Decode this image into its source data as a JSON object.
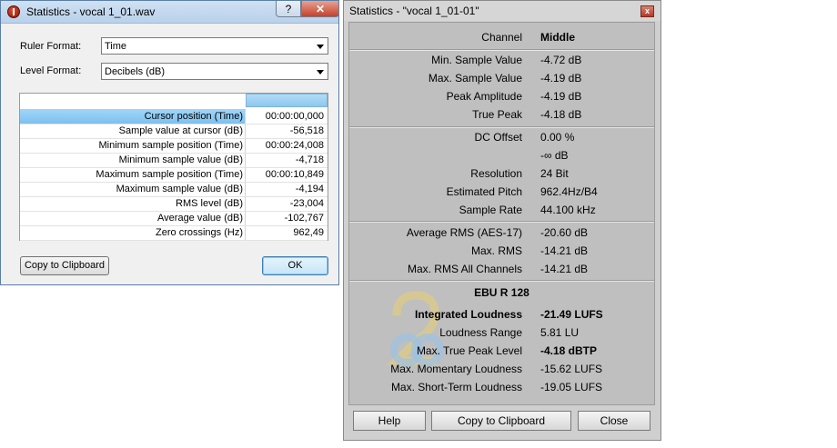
{
  "left_dialog": {
    "title": "Statistics - vocal 1_01.wav",
    "help_caption": "?",
    "close_caption": "✕",
    "ruler_label": "Ruler Format:",
    "ruler_value": "Time",
    "level_label": "Level Format:",
    "level_value": "Decibels (dB)",
    "rows": [
      {
        "label": "Cursor position (Time)",
        "value": "00:00:00,000"
      },
      {
        "label": "Sample value at cursor (dB)",
        "value": "-56,518"
      },
      {
        "label": "Minimum sample position (Time)",
        "value": "00:00:24,008"
      },
      {
        "label": "Minimum sample value (dB)",
        "value": "-4,718"
      },
      {
        "label": "Maximum sample position (Time)",
        "value": "00:00:10,849"
      },
      {
        "label": "Maximum sample value (dB)",
        "value": "-4,194"
      },
      {
        "label": "RMS level (dB)",
        "value": "-23,004"
      },
      {
        "label": "Average value (dB)",
        "value": "-102,767"
      },
      {
        "label": "Zero crossings (Hz)",
        "value": "962,49"
      }
    ],
    "copy_button": "Copy to Clipboard",
    "ok_button": "OK"
  },
  "right_dialog": {
    "title": "Statistics - \"vocal 1_01-01\"",
    "close_caption": "x",
    "channel_label": "Channel",
    "channel_value": "Middle",
    "group1": [
      {
        "label": "Min. Sample Value",
        "value": "-4.72 dB"
      },
      {
        "label": "Max. Sample Value",
        "value": "-4.19 dB"
      },
      {
        "label": "Peak Amplitude",
        "value": "-4.19 dB"
      },
      {
        "label": "True Peak",
        "value": "-4.18 dB"
      }
    ],
    "group2": [
      {
        "label": "DC Offset",
        "value": "0.00 %"
      },
      {
        "label": "",
        "value": "-∞ dB"
      },
      {
        "label": "Resolution",
        "value": "24 Bit"
      },
      {
        "label": "Estimated Pitch",
        "value": "962.4Hz/B4"
      },
      {
        "label": "Sample Rate",
        "value": "44.100 kHz"
      }
    ],
    "group3": [
      {
        "label": "Average RMS (AES-17)",
        "value": "-20.60 dB"
      },
      {
        "label": "Max. RMS",
        "value": "-14.21 dB"
      },
      {
        "label": "Max. RMS All Channels",
        "value": "-14.21 dB"
      }
    ],
    "ebu_title": "EBU R 128",
    "group4": [
      {
        "label": "Integrated Loudness",
        "value": "-21.49 LUFS"
      },
      {
        "label": "Loudness Range",
        "value": "5.81 LU"
      },
      {
        "label": "Max. True Peak Level",
        "value": "-4.18 dBTP"
      },
      {
        "label": "Max. Momentary Loudness",
        "value": "-15.62 LUFS"
      },
      {
        "label": "Max. Short-Term Loudness",
        "value": "-19.05 LUFS"
      }
    ],
    "help_button": "Help",
    "copy_button": "Copy to Clipboard",
    "close_button": "Close"
  },
  "colors": {
    "selection": "#8cc7ef",
    "ok_border": "#3c7fb1",
    "close_red": "#c5412c"
  }
}
